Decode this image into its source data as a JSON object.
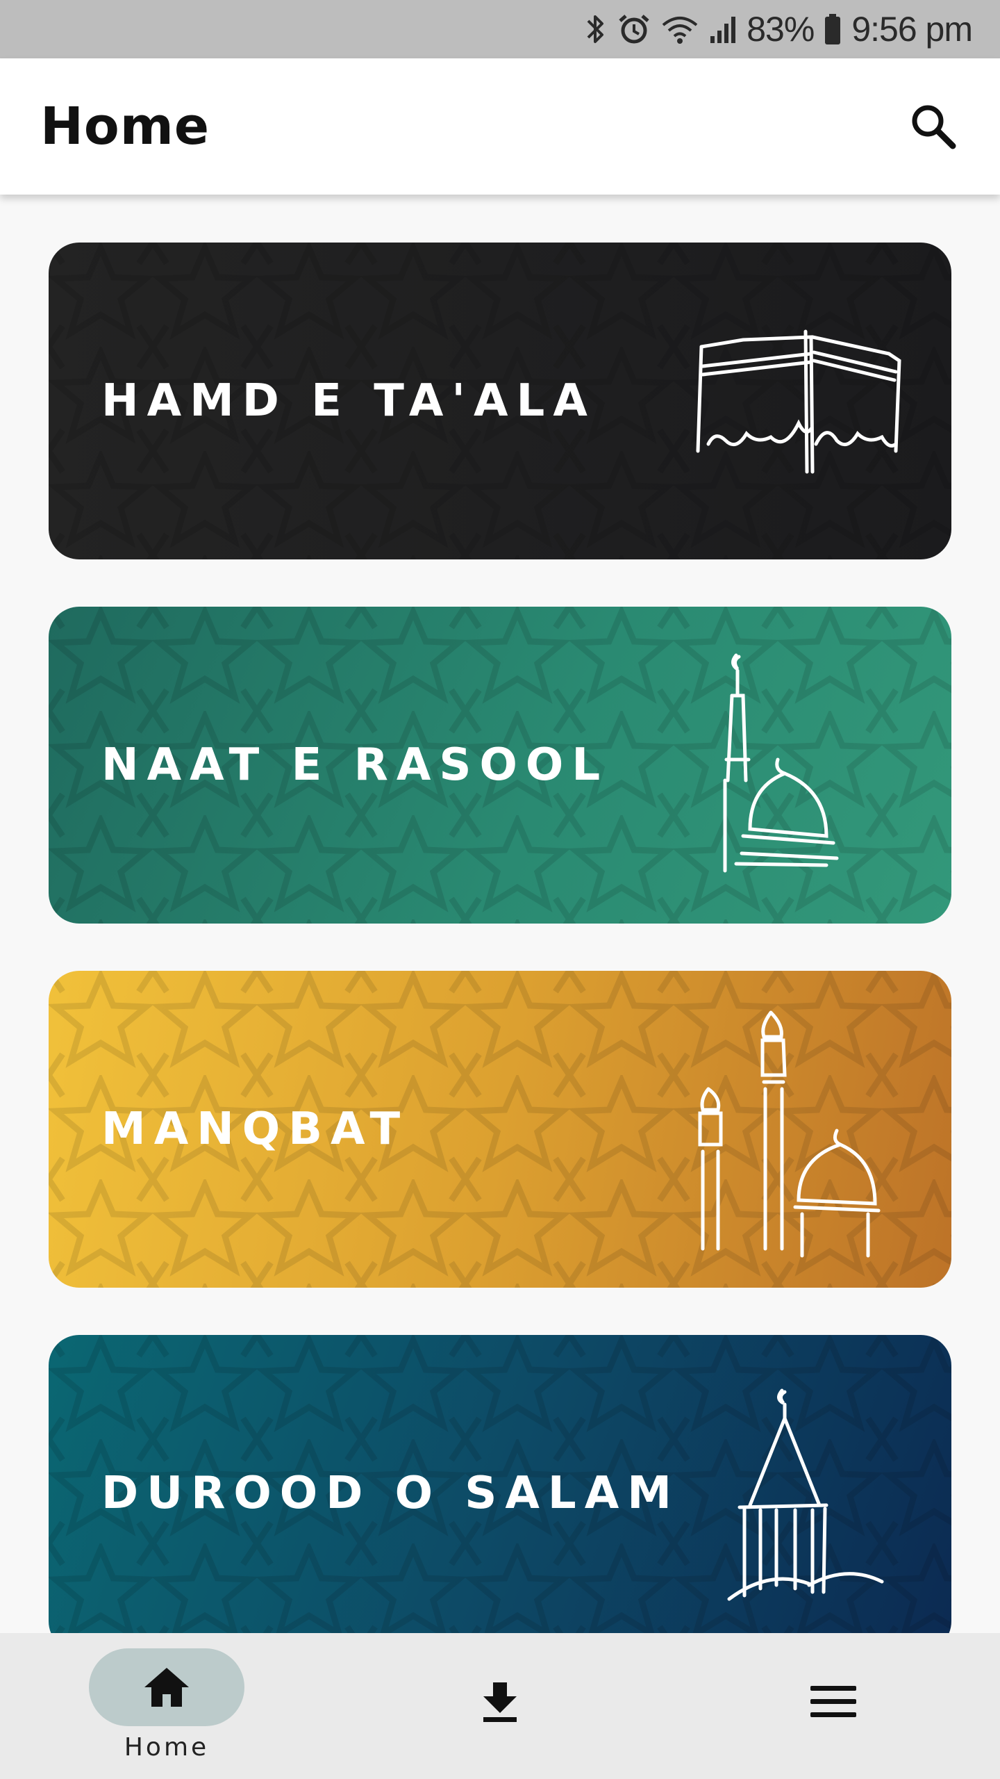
{
  "status_bar": {
    "battery": "83%",
    "time": "9:56 pm",
    "icons": [
      "bluetooth-icon",
      "alarm-icon",
      "wifi-icon",
      "signal-icon",
      "battery-icon"
    ]
  },
  "app_bar": {
    "title": "Home",
    "search_icon": "search-icon"
  },
  "cards": [
    {
      "label": "HAMD E TA'ALA",
      "icon": "kaaba-icon",
      "colors": [
        "#232323",
        "#1b1b1d"
      ]
    },
    {
      "label": "NAAT E RASOOL",
      "icon": "green-dome-icon",
      "colors": [
        "#1f6a5e",
        "#33987a"
      ]
    },
    {
      "label": "MANQBAT",
      "icon": "shrine-icon",
      "colors": [
        "#f1c13a",
        "#bd7328"
      ]
    },
    {
      "label": "DUROOD O SALAM",
      "icon": "mosque-minaret-icon",
      "colors": [
        "#0b6772",
        "#0c2a52"
      ]
    }
  ],
  "bottom_nav": {
    "home_label": "Home",
    "items": [
      "home-icon",
      "download-icon",
      "menu-icon"
    ],
    "active": "home"
  }
}
